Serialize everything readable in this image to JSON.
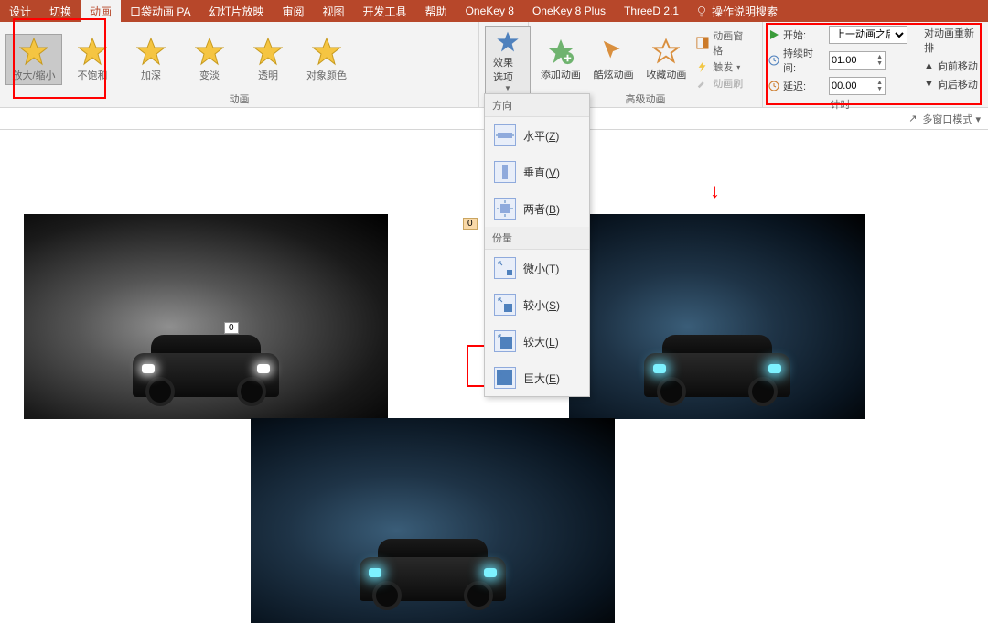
{
  "tabs": {
    "items": [
      "设计",
      "切换",
      "动画",
      "口袋动画 PA",
      "幻灯片放映",
      "审阅",
      "视图",
      "开发工具",
      "帮助",
      "OneKey 8",
      "OneKey 8 Plus",
      "ThreeD 2.1"
    ],
    "active_index": 2,
    "search_placeholder": "操作说明搜索"
  },
  "ribbon": {
    "anim_group_label": "动画",
    "adv_group_label": "高级动画",
    "timing_group_label": "计时",
    "animations": [
      {
        "label": "放大/缩小",
        "color": "#f5c542",
        "selected": true
      },
      {
        "label": "不饱和",
        "color": "#f5c542"
      },
      {
        "label": "加深",
        "color": "#f5c542"
      },
      {
        "label": "变淡",
        "color": "#f5c542"
      },
      {
        "label": "透明",
        "color": "#f5c542"
      },
      {
        "label": "对象颜色",
        "color": "#f5c542"
      }
    ],
    "effect_options": "效果选项",
    "adv": {
      "add": "添加动画",
      "cool": "酷炫动画",
      "collect": "收藏动画",
      "pane": "动画窗格",
      "trigger": "触发",
      "painter": "动画刷"
    },
    "timing": {
      "start_label": "开始:",
      "start_value": "上一动画之后",
      "duration_label": "持续时间:",
      "duration_value": "01.00",
      "delay_label": "延迟:",
      "delay_value": "00.00"
    },
    "reorder": {
      "title": "对动画重新排",
      "up": "向前移动",
      "down": "向后移动"
    }
  },
  "menu": {
    "section1": "方向",
    "items1": [
      {
        "icon": "h",
        "label": "水平",
        "key": "Z"
      },
      {
        "icon": "v",
        "label": "垂直",
        "key": "V"
      },
      {
        "icon": "b",
        "label": "两者",
        "key": "B"
      }
    ],
    "section2": "份量",
    "items2": [
      {
        "icon": "s1",
        "label": "微小",
        "key": "T"
      },
      {
        "icon": "s2",
        "label": "较小",
        "key": "S"
      },
      {
        "icon": "s3",
        "label": "较大",
        "key": "L",
        "highlight": true
      },
      {
        "icon": "s4",
        "label": "巨大",
        "key": "E"
      }
    ]
  },
  "toolbar2": {
    "multi": "多窗口模式"
  },
  "canvas": {
    "tag": "0"
  }
}
